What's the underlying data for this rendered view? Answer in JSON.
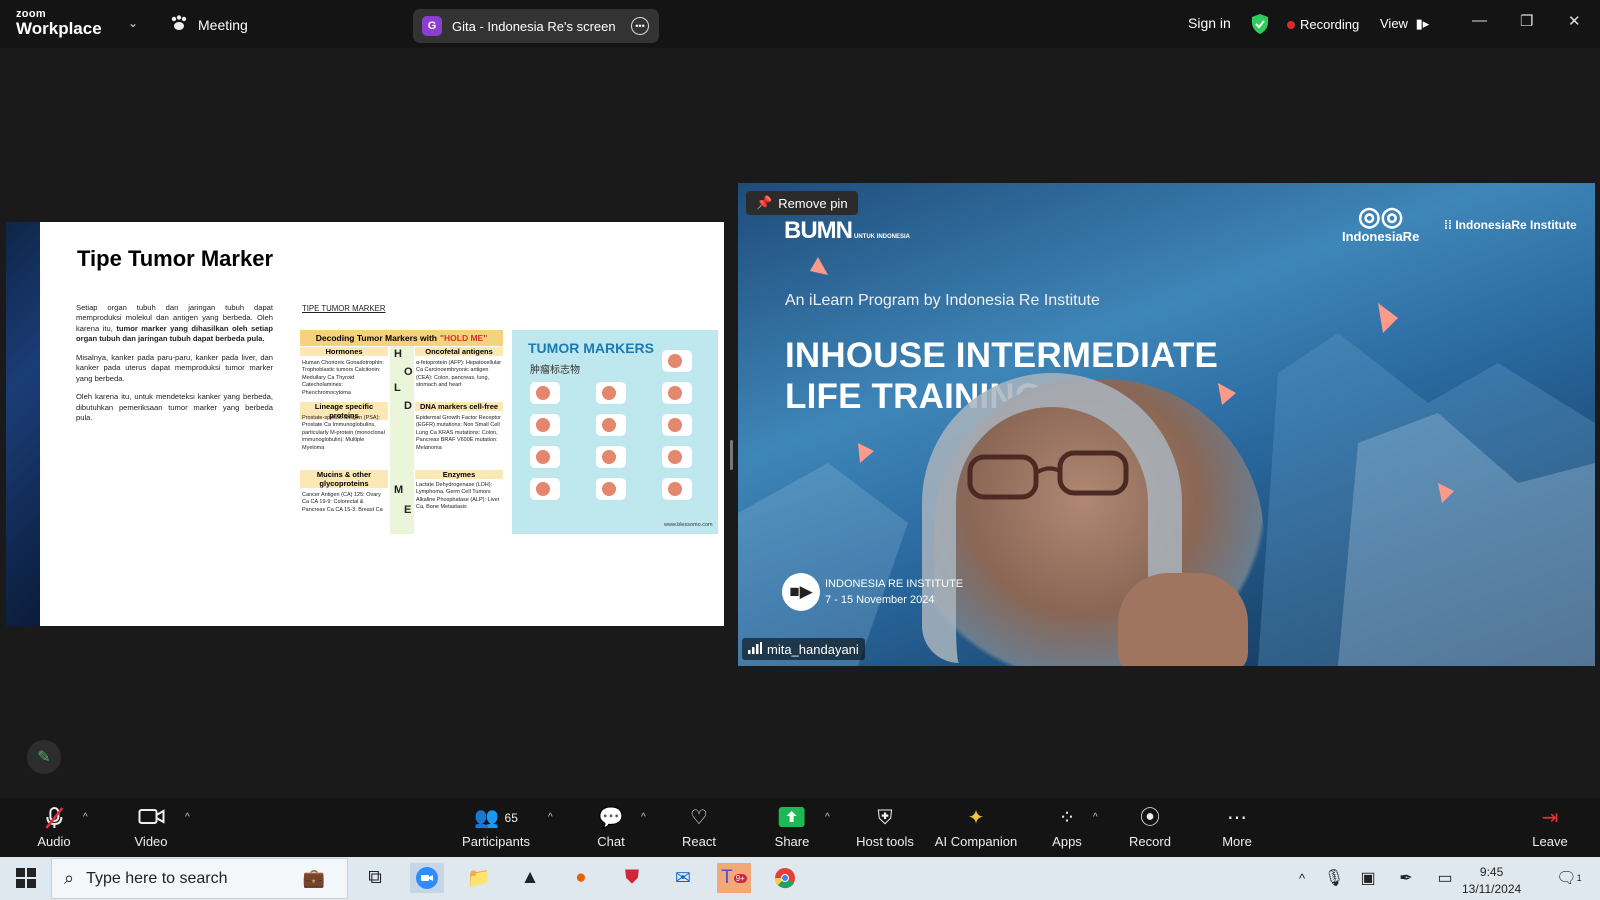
{
  "titlebar": {
    "logo_top": "zoom",
    "logo_bottom": "Workplace",
    "meeting_label": "Meeting",
    "screen_share_label": "Gita - Indonesia Re's screen",
    "screen_share_initial": "G",
    "sign_in": "Sign in",
    "recording": "Recording",
    "view": "View"
  },
  "slide": {
    "title": "Tipe Tumor Marker",
    "paragraph1_a": "Setiap organ tubuh dan jaringan tubuh dapat memproduksi molekul dan antigen yang berbeda. Oleh karena itu, ",
    "paragraph1_b": "tumor marker yang dihasilkan oleh setiap organ tubuh dan jaringan tubuh dapat berbeda pula.",
    "paragraph2": "Misalnya, kanker pada paru-paru, kanker pada liver, dan kanker pada uterus dapat memproduksi tumor marker yang berbeda.",
    "paragraph3": "Oleh karena itu, untuk mendeteksi kanker yang berbeda, dibutuhkan pemeriksaan tumor marker yang berbeda pula.",
    "subheading": "TIPE TUMOR MARKER",
    "infographic1": {
      "header_a": "Decoding Tumor Markers with",
      "header_b": "\"HOLD ME\"",
      "hormones": "Hormones",
      "oncofetal": "Oncofetal antigens",
      "lineage": "Lineage specific proteins",
      "dna": "DNA markers cell-free",
      "mucins": "Mucins & other glycoproteins",
      "enzymes": "Enzymes",
      "letters": [
        "H",
        "O",
        "L",
        "D",
        "M",
        "E"
      ],
      "hormones_list": "Human Chorionic Gonadotrophin: Trophoblastic tumors Calcitonin: Medullary Ca Thyroid Catecholamines: Pheochromocytoma",
      "oncofetal_list": "α-fetoprotein (AFP): Hepatocellular Ca Carcinoembryonic antigen (CEA): Colon, pancreas, lung, stomach and heart",
      "lineage_list": "Prostate-specific antigen (PSA): Prostate Ca Immunoglobulins, particularly M-protein (monoclonal immunoglobulin): Multiple Myeloma",
      "dna_list": "Epidermal Growth Factor Receptor (EGFR) mutations: Non Small Cell Lung Ca KRAS mutations: Colon, Pancreas BRAF V600E mutation: Melanoma",
      "mucins_list": "Cancer Antigen (CA) 125: Ovary Ca CA 19-9: Colorectal & Pancreas Ca CA 15-3: Breast Ca",
      "enzymes_list": "Lactate Dehydrogenase (LDH): Lymphoma, Germ Cell Tumors Alkaline Phosphatase (ALP): Liver Ca, Bone Metastasis"
    },
    "infographic2": {
      "title": "TUMOR MARKERS",
      "subtitle": "肿瘤标志物",
      "url": "www.blessomo.com"
    }
  },
  "video": {
    "remove_pin": "Remove pin",
    "bumn": "BUMN",
    "bumn_small": "UNTUK INDONESIA",
    "ire_logo": "IndonesiaRe",
    "iri_logo": "IndonesiaRe Institute",
    "ilearn": "An iLearn Program by Indonesia Re Institute",
    "headline_line1": "INHOUSE INTERMEDIATE",
    "headline_line2": "LIFE TRAINING 2024",
    "institute": "INDONESIA RE INSTITUTE",
    "dates": "7 - 15 November 2024",
    "username": "mita_handayani"
  },
  "toolbar": {
    "audio": "Audio",
    "video": "Video",
    "participants": "Participants",
    "participants_count": "65",
    "chat": "Chat",
    "react": "React",
    "share": "Share",
    "host_tools": "Host tools",
    "ai_companion": "AI Companion",
    "apps": "Apps",
    "record": "Record",
    "more": "More",
    "leave": "Leave"
  },
  "taskbar": {
    "search_placeholder": "Type here to search",
    "time": "9:45",
    "date": "13/11/2024",
    "teams_badge": "9+",
    "notification_count": "1"
  },
  "colors": {
    "share_green": "#1db954",
    "recording_red": "#e02828",
    "shield_green": "#2ecc5a",
    "leave_red": "#e0303a",
    "ai_gold": "#f0c040"
  }
}
